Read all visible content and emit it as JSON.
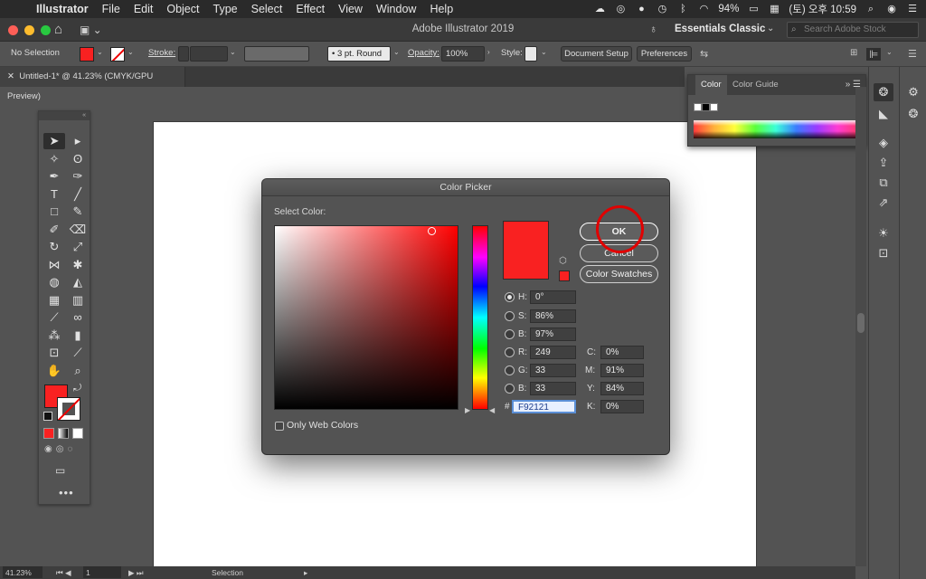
{
  "menubar": {
    "app": "Illustrator",
    "items": [
      "File",
      "Edit",
      "Object",
      "Type",
      "Select",
      "Effect",
      "View",
      "Window",
      "Help"
    ],
    "battery": "94%",
    "clock": "(토) 오후 10:59"
  },
  "titlebar": {
    "title": "Adobe Illustrator 2019",
    "workspace": "Essentials Classic",
    "search_placeholder": "Search Adobe Stock"
  },
  "controlbar": {
    "selection": "No Selection",
    "stroke_label": "Stroke:",
    "brush": "3 pt. Round",
    "opacity_label": "Opacity:",
    "opacity_value": "100%",
    "style_label": "Style:",
    "document_setup": "Document Setup",
    "preferences": "Preferences"
  },
  "document": {
    "tab": "Untitled-1* @ 41.23% (CMYK/GPU Preview)"
  },
  "color_panel": {
    "tabs": [
      "Color",
      "Color Guide"
    ]
  },
  "dialog": {
    "title": "Color Picker",
    "select_color": "Select Color:",
    "ok": "OK",
    "cancel": "Cancel",
    "swatches": "Color Swatches",
    "web_colors": "Only Web Colors",
    "current_color": "#f92121",
    "hsb": {
      "h": "0°",
      "s": "86%",
      "b": "97%"
    },
    "rgb": {
      "r": "249",
      "g": "33",
      "b": "33"
    },
    "cmyk": {
      "c": "0%",
      "m": "91%",
      "y": "84%",
      "k": "0%"
    },
    "hex": "F92121"
  },
  "statusbar": {
    "zoom": "41.23%",
    "artboard": "1",
    "mode": "Selection"
  },
  "colors": {
    "fill": "#f92121",
    "accent_circle": "#e10000"
  }
}
